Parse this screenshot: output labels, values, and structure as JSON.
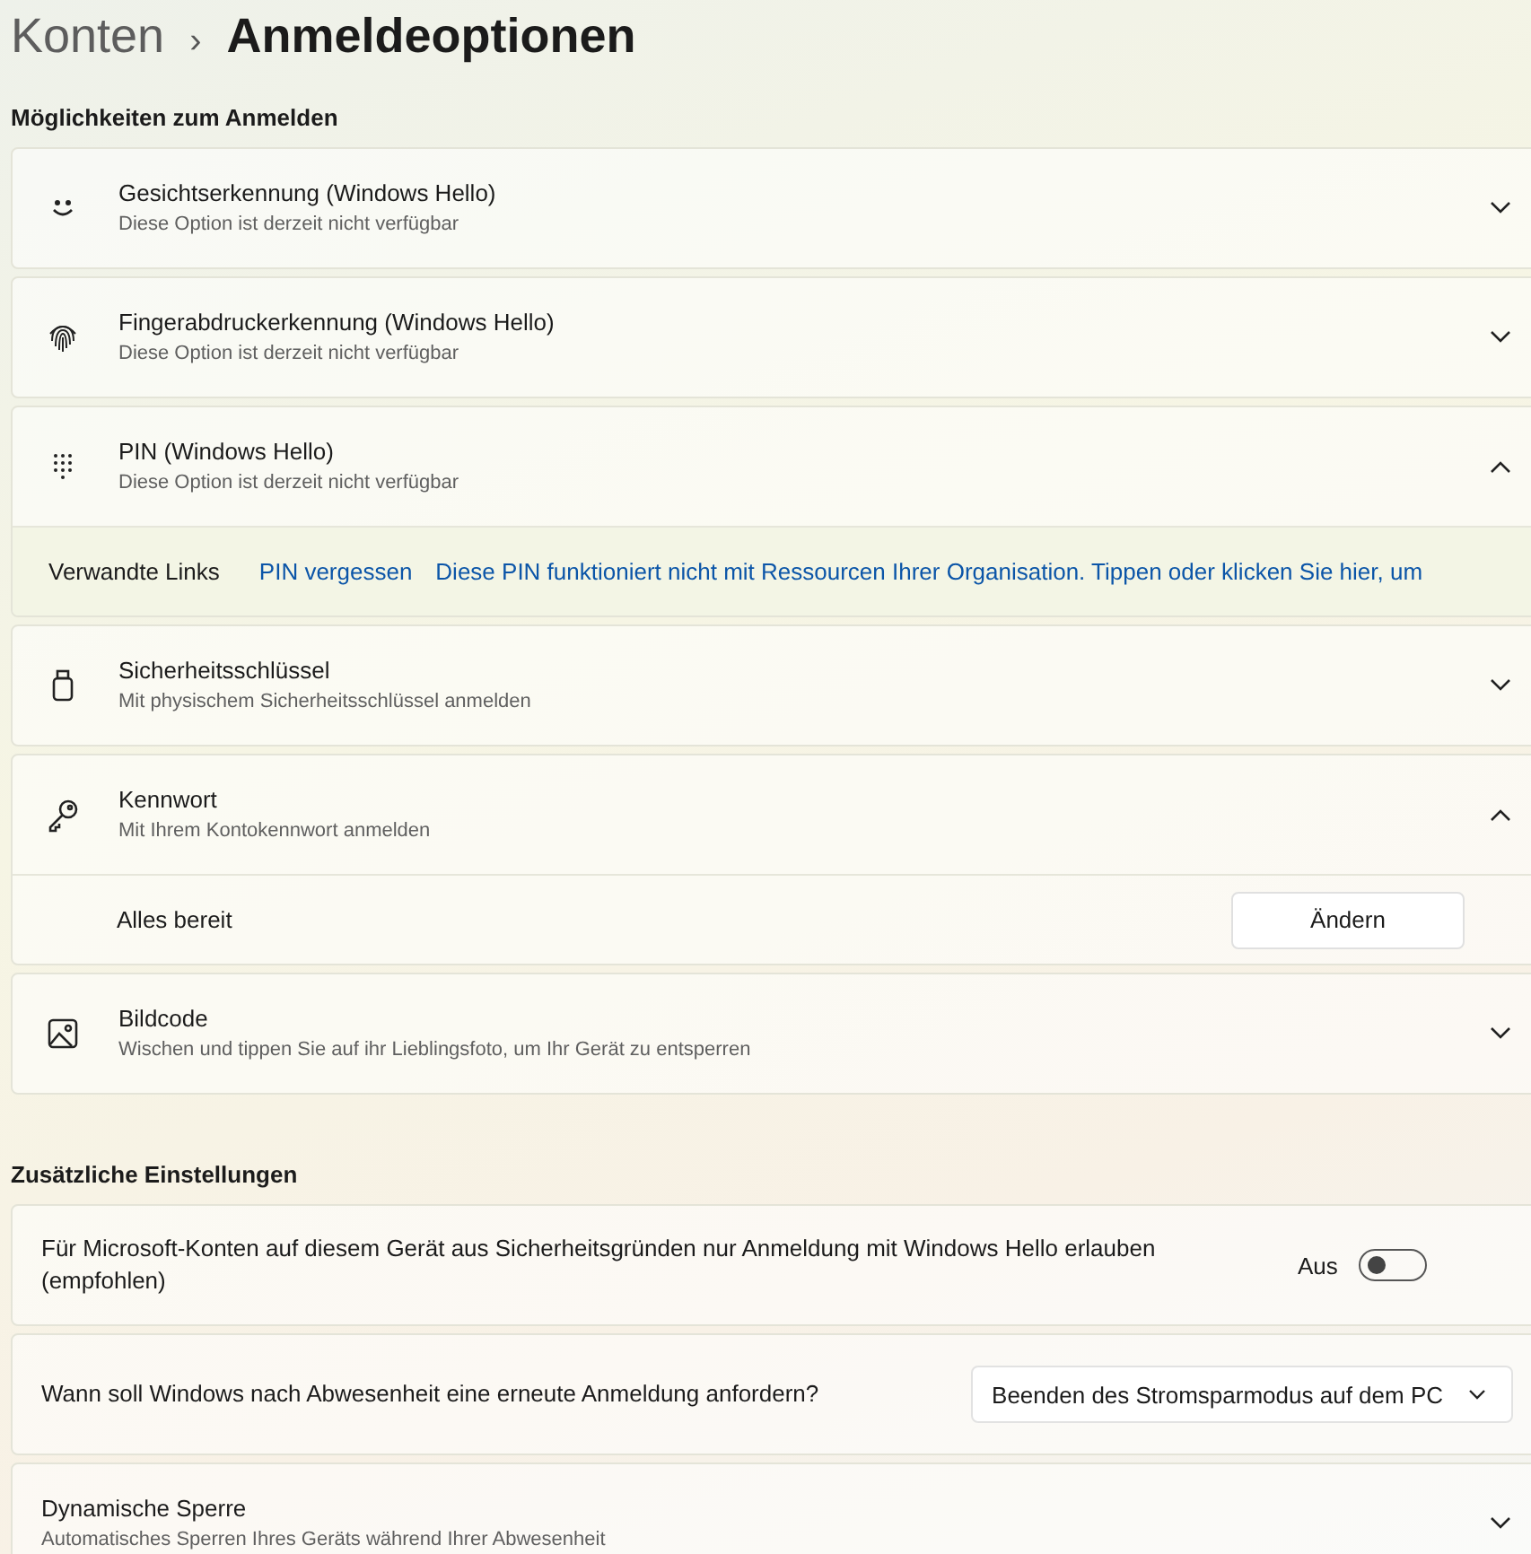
{
  "breadcrumb": {
    "parent": "Konten",
    "separator": "›",
    "current": "Anmeldeoptionen"
  },
  "sign_in_section": {
    "heading": "Möglichkeiten zum Anmelden",
    "options": [
      {
        "title": "Gesichtserkennung (Windows Hello)",
        "subtitle": "Diese Option ist derzeit nicht verfügbar",
        "expanded": false
      },
      {
        "title": "Fingerabdruckerkennung (Windows Hello)",
        "subtitle": "Diese Option ist derzeit nicht verfügbar",
        "expanded": false
      },
      {
        "title": "PIN (Windows Hello)",
        "subtitle": "Diese Option ist derzeit nicht verfügbar",
        "expanded": true,
        "detail": {
          "kind": "links",
          "label": "Verwandte Links",
          "links": [
            "PIN vergessen",
            "Diese PIN funktioniert nicht mit Ressourcen Ihrer Organisation. Tippen oder klicken Sie hier, um"
          ]
        }
      },
      {
        "title": "Sicherheitsschlüssel",
        "subtitle": "Mit physischem Sicherheitsschlüssel anmelden",
        "expanded": false
      },
      {
        "title": "Kennwort",
        "subtitle": "Mit Ihrem Kontokennwort anmelden",
        "expanded": true,
        "detail": {
          "kind": "action",
          "label": "Alles bereit",
          "button": "Ändern"
        }
      },
      {
        "title": "Bildcode",
        "subtitle": "Wischen und tippen Sie auf ihr Lieblingsfoto, um Ihr Gerät zu entsperren",
        "expanded": false
      }
    ]
  },
  "additional_section": {
    "heading": "Zusätzliche Einstellungen",
    "settings": [
      {
        "kind": "toggle",
        "text": "Für Microsoft-Konten auf diesem Gerät aus Sicherheitsgründen nur Anmeldung mit Windows Hello erlauben (empfohlen)",
        "state_label": "Aus",
        "on": false
      },
      {
        "kind": "dropdown",
        "text": "Wann soll Windows nach Abwesenheit eine erneute Anmeldung anfordern?",
        "value": "Beenden des Stromsparmodus auf dem PC"
      },
      {
        "kind": "expander",
        "title": "Dynamische Sperre",
        "subtitle": "Automatisches Sperren Ihres Geräts während Ihrer Abwesenheit",
        "expanded": false
      }
    ]
  }
}
